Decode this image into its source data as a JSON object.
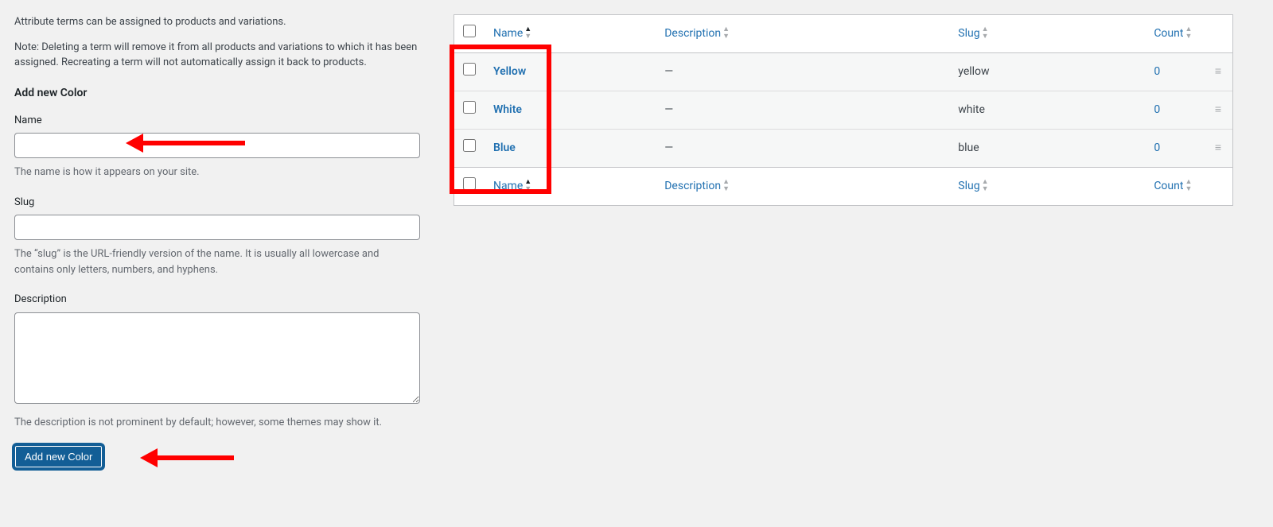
{
  "intro": {
    "p1": "Attribute terms can be assigned to products and variations.",
    "p2": "Note: Deleting a term will remove it from all products and variations to which it has been assigned. Recreating a term will not automatically assign it back to products."
  },
  "form": {
    "heading": "Add new Color",
    "name_label": "Name",
    "name_value": "",
    "name_help": "The name is how it appears on your site.",
    "slug_label": "Slug",
    "slug_value": "",
    "slug_help": "The “slug” is the URL-friendly version of the name. It is usually all lowercase and contains only letters, numbers, and hyphens.",
    "desc_label": "Description",
    "desc_value": "",
    "desc_help": "The description is not prominent by default; however, some themes may show it.",
    "submit_label": "Add new Color"
  },
  "table": {
    "columns": {
      "name": "Name",
      "description": "Description",
      "slug": "Slug",
      "count": "Count"
    },
    "rows": [
      {
        "name": "Yellow",
        "description": "—",
        "slug": "yellow",
        "count": "0"
      },
      {
        "name": "White",
        "description": "—",
        "slug": "white",
        "count": "0"
      },
      {
        "name": "Blue",
        "description": "—",
        "slug": "blue",
        "count": "0"
      }
    ],
    "drag_glyph": "≡"
  }
}
